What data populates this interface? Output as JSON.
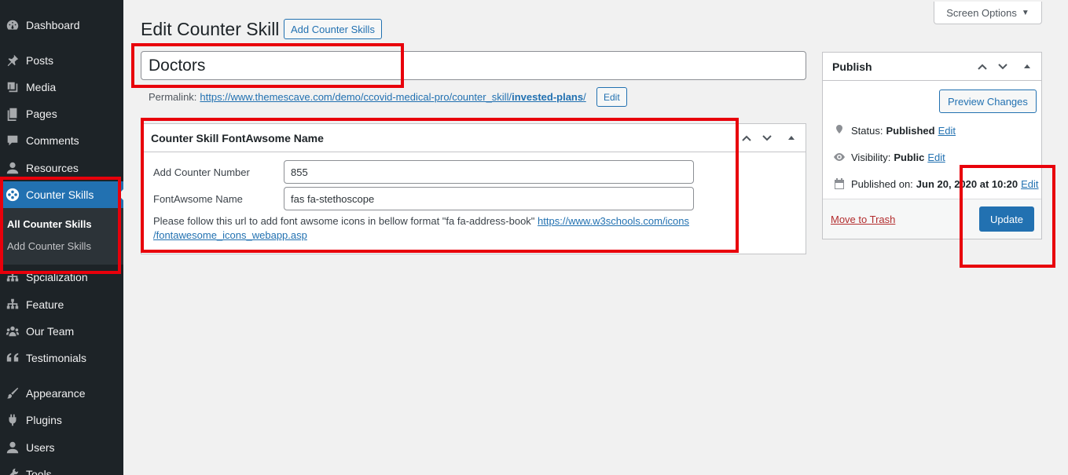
{
  "sidebar": {
    "items": [
      {
        "label": "Dashboard",
        "icon": "dashboard-icon"
      },
      {
        "label": "Posts",
        "icon": "pin-icon"
      },
      {
        "label": "Media",
        "icon": "media-icon"
      },
      {
        "label": "Pages",
        "icon": "pages-icon"
      },
      {
        "label": "Comments",
        "icon": "comment-icon"
      },
      {
        "label": "Resources",
        "icon": "person-icon"
      },
      {
        "label": "Counter Skills",
        "icon": "film-reel-icon"
      },
      {
        "label": "Spcialization",
        "icon": "network-icon"
      },
      {
        "label": "Feature",
        "icon": "network-icon"
      },
      {
        "label": "Our Team",
        "icon": "groups-icon"
      },
      {
        "label": "Testimonials",
        "icon": "quote-icon"
      },
      {
        "label": "Appearance",
        "icon": "paint-brush-icon"
      },
      {
        "label": "Plugins",
        "icon": "plug-icon"
      },
      {
        "label": "Users",
        "icon": "person-icon"
      },
      {
        "label": "Tools",
        "icon": "wrench-icon"
      }
    ],
    "submenu": {
      "all": "All Counter Skills",
      "add": "Add Counter Skills"
    }
  },
  "header": {
    "title": "Edit Counter Skill",
    "add_new": "Add Counter Skills",
    "screen_options": "Screen Options"
  },
  "post": {
    "title_value": "Doctors",
    "permalink_label": "Permalink:",
    "permalink_url_base": "https://www.themescave.com/demo/ccovid-medical-pro/counter_skill/",
    "permalink_slug": "invested-plans",
    "permalink_trail": "/",
    "permalink_edit": "Edit"
  },
  "metabox": {
    "title": "Counter Skill FontAwsome Name",
    "fields": [
      {
        "label": "Add Counter Number",
        "value": "855"
      },
      {
        "label": "FontAwsome Name",
        "value": "fas fa-stethoscope"
      }
    ],
    "help_prefix": "Please follow this url to add font awsome icons in bellow format \"fa fa-address-book\"",
    "help_link_line1": "https://www.w3schools.com/icons",
    "help_link_line2": "/fontawesome_icons_webapp.asp"
  },
  "publish": {
    "title": "Publish",
    "preview": "Preview Changes",
    "status_label": "Status:",
    "status_value": "Published",
    "visibility_label": "Visibility:",
    "visibility_value": "Public",
    "published_label": "Published on:",
    "published_value": "Jun 20, 2020 at 10:20",
    "edit": "Edit",
    "trash": "Move to Trash",
    "update": "Update"
  },
  "colors": {
    "sidebar_bg": "#1d2327",
    "accent": "#2271b1",
    "annotation_red": "#e8000b"
  }
}
